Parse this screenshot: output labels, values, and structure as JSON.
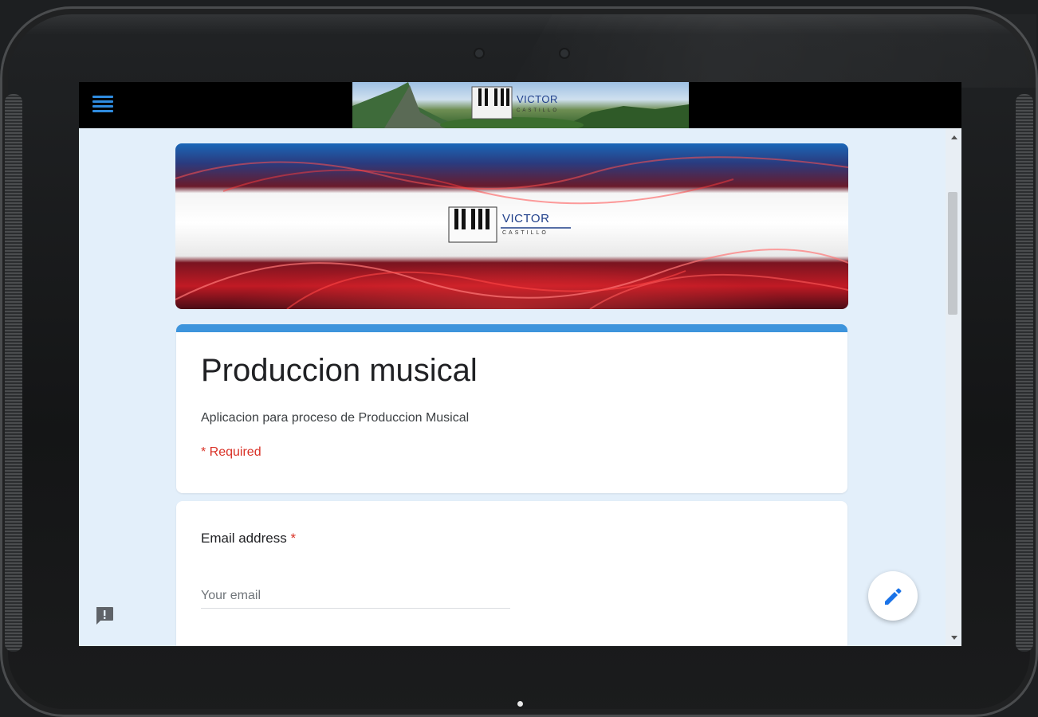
{
  "form": {
    "title": "Produccion musical",
    "description": "Aplicacion para proceso de Produccion Musical",
    "required_note": "* Required"
  },
  "email": {
    "label": "Email address",
    "required_mark": "*",
    "placeholder": "Your email",
    "value": ""
  },
  "brand": {
    "logo_name": "VICTOR",
    "logo_surname": "CASTILLO"
  },
  "icons": {
    "menu": "hamburger-menu-icon",
    "feedback": "report-feedback-icon",
    "edit": "pencil-edit-icon"
  },
  "colors": {
    "accent": "#3d94dc",
    "required": "#d93025",
    "page_background": "#e3effa",
    "topbar": "#000000"
  }
}
